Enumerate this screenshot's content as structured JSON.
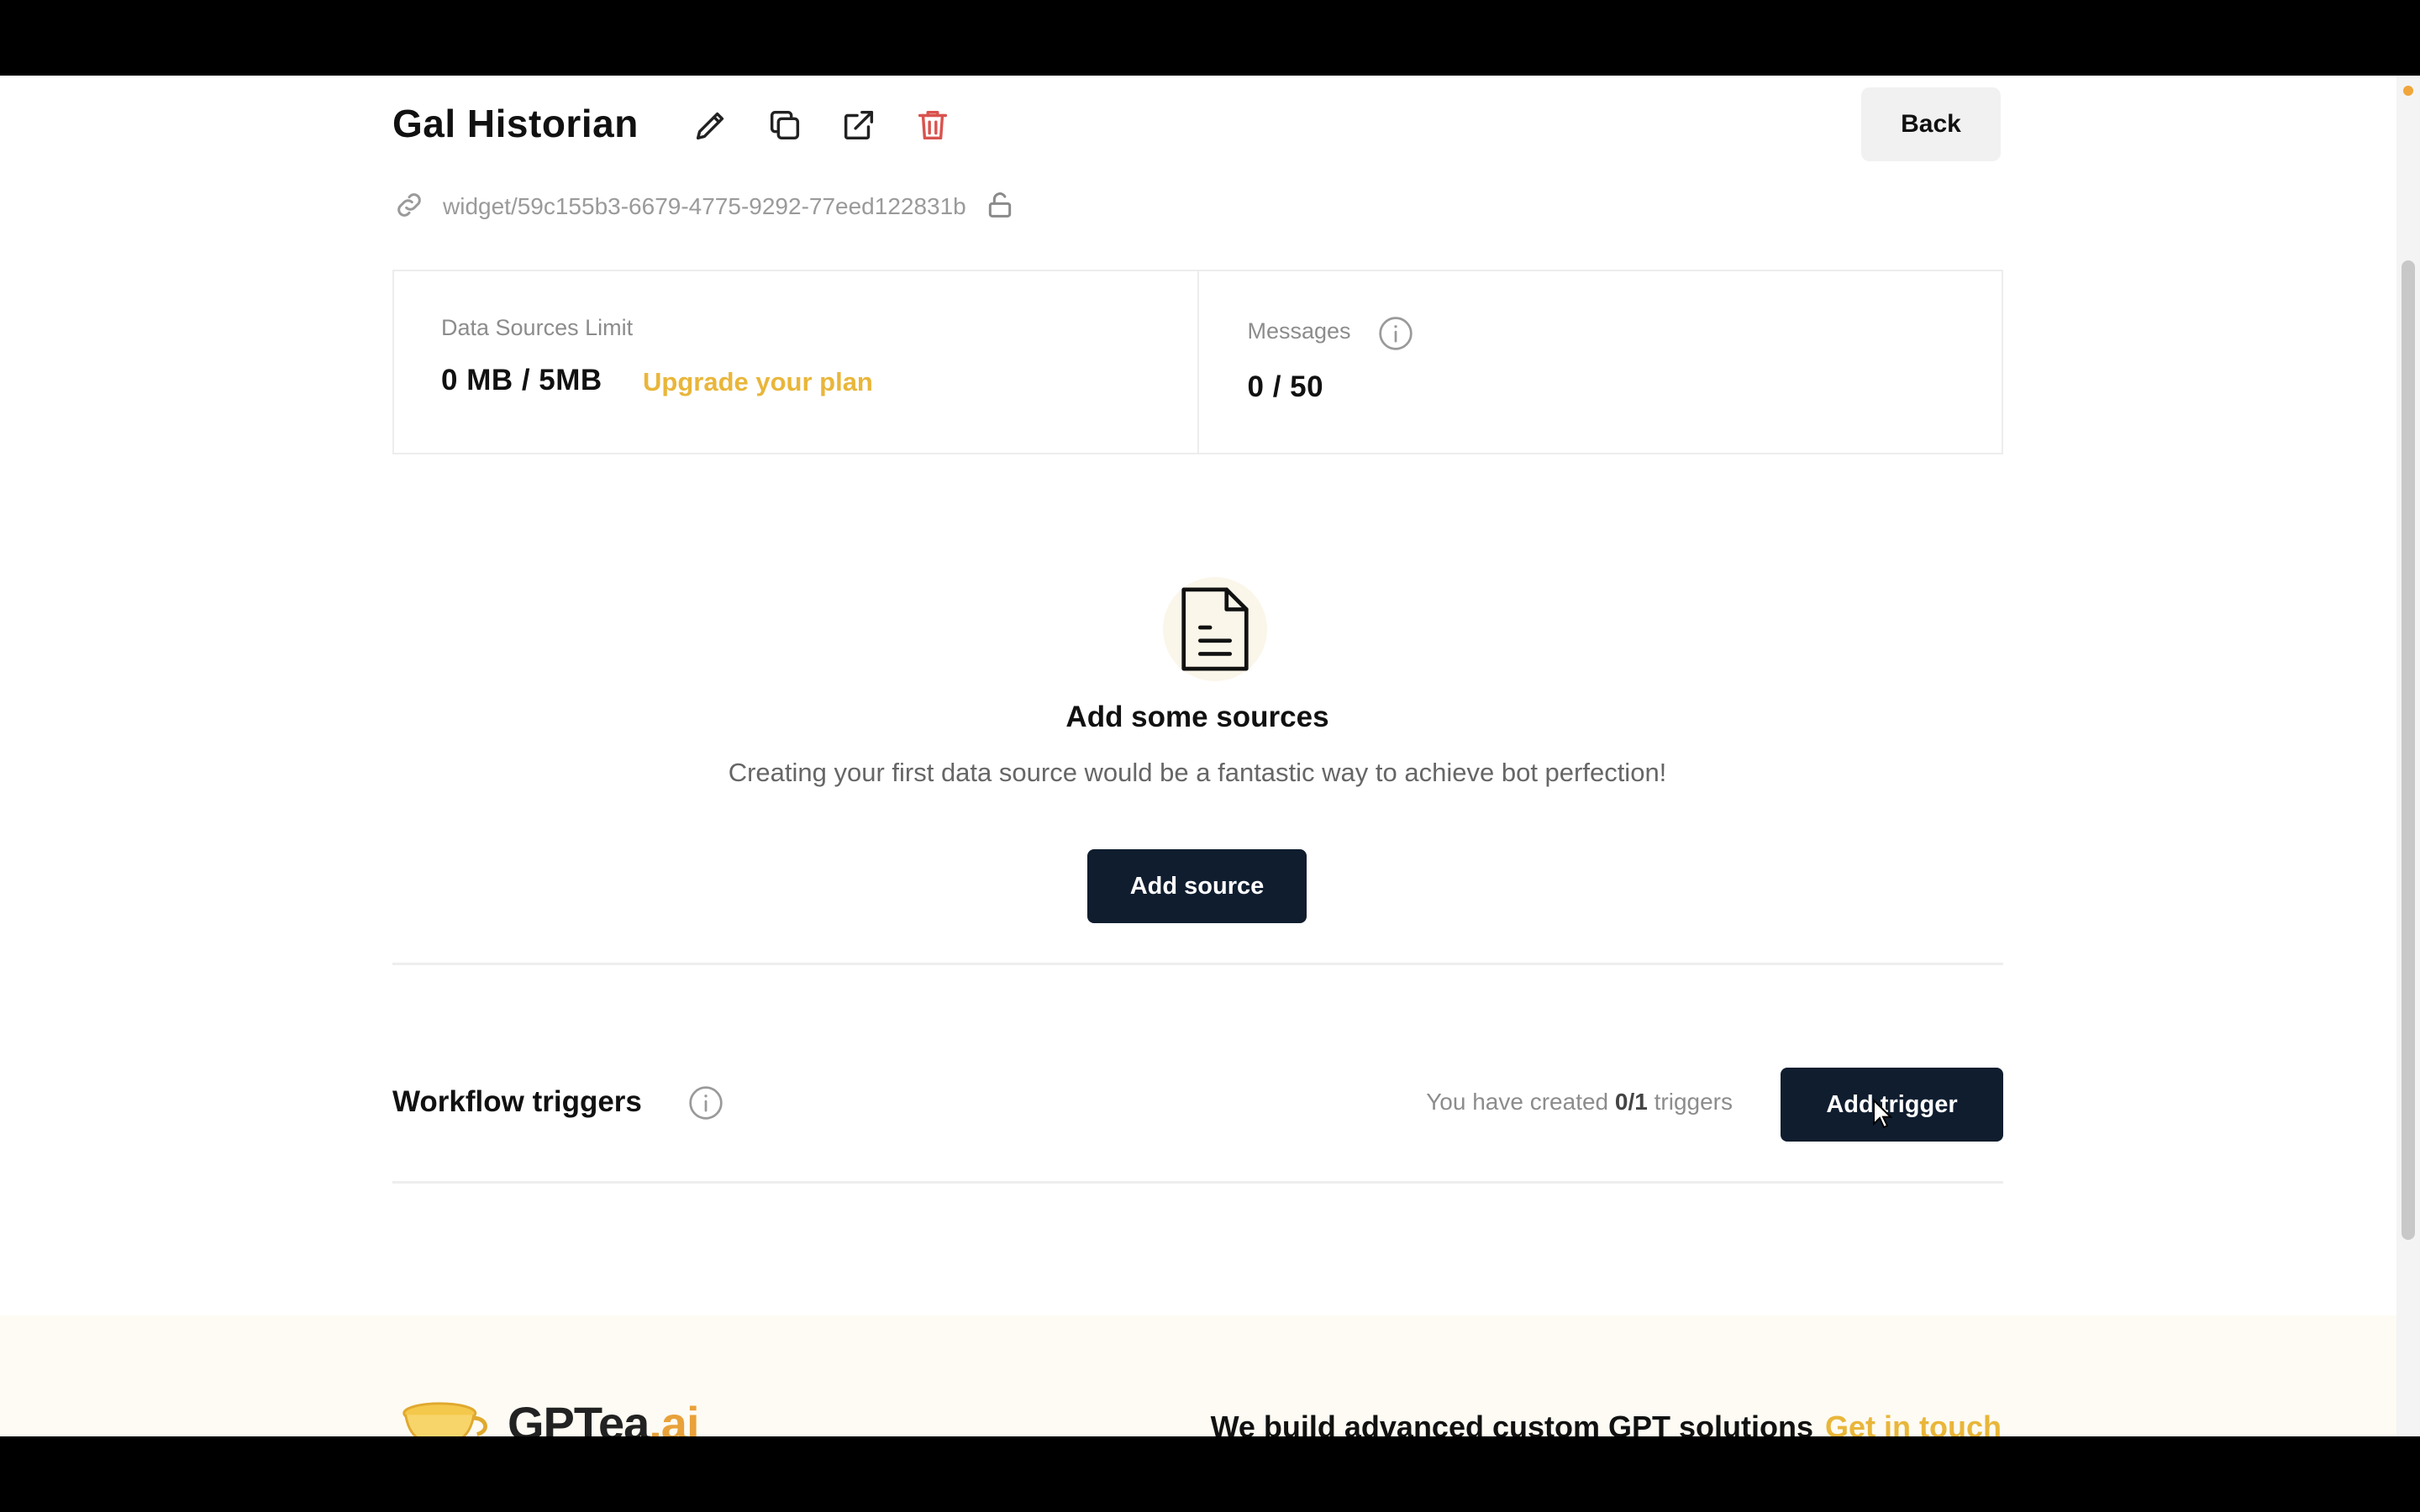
{
  "header": {
    "title": "Gal Historian",
    "back_label": "Back",
    "widget_path": "widget/59c155b3-6679-4775-9292-77eed122831b",
    "icons": [
      "edit-icon",
      "copy-icon",
      "external-link-icon",
      "trash-icon",
      "link-icon",
      "lock-icon"
    ]
  },
  "stats": {
    "data_sources": {
      "label": "Data Sources Limit",
      "value": "0 MB / 5MB",
      "upgrade_link": "Upgrade your plan"
    },
    "messages": {
      "label": "Messages",
      "value": "0 / 50"
    }
  },
  "empty_state": {
    "title": "Add some sources",
    "subtitle": "Creating your first data source would be a fantastic way to achieve bot perfection!",
    "button_label": "Add source"
  },
  "triggers": {
    "title": "Workflow triggers",
    "count_prefix": "You have created",
    "count_value": "0/1",
    "count_suffix": "triggers",
    "button_label": "Add trigger"
  },
  "footer": {
    "logo_text": "GPTea",
    "logo_suffix": ".ai",
    "tagline": "We build advanced custom GPT solutions",
    "cta": "Get in touch"
  },
  "colors": {
    "accent": "#e9b63a",
    "button_dark": "#0f1d2f",
    "danger": "#d9534f"
  }
}
